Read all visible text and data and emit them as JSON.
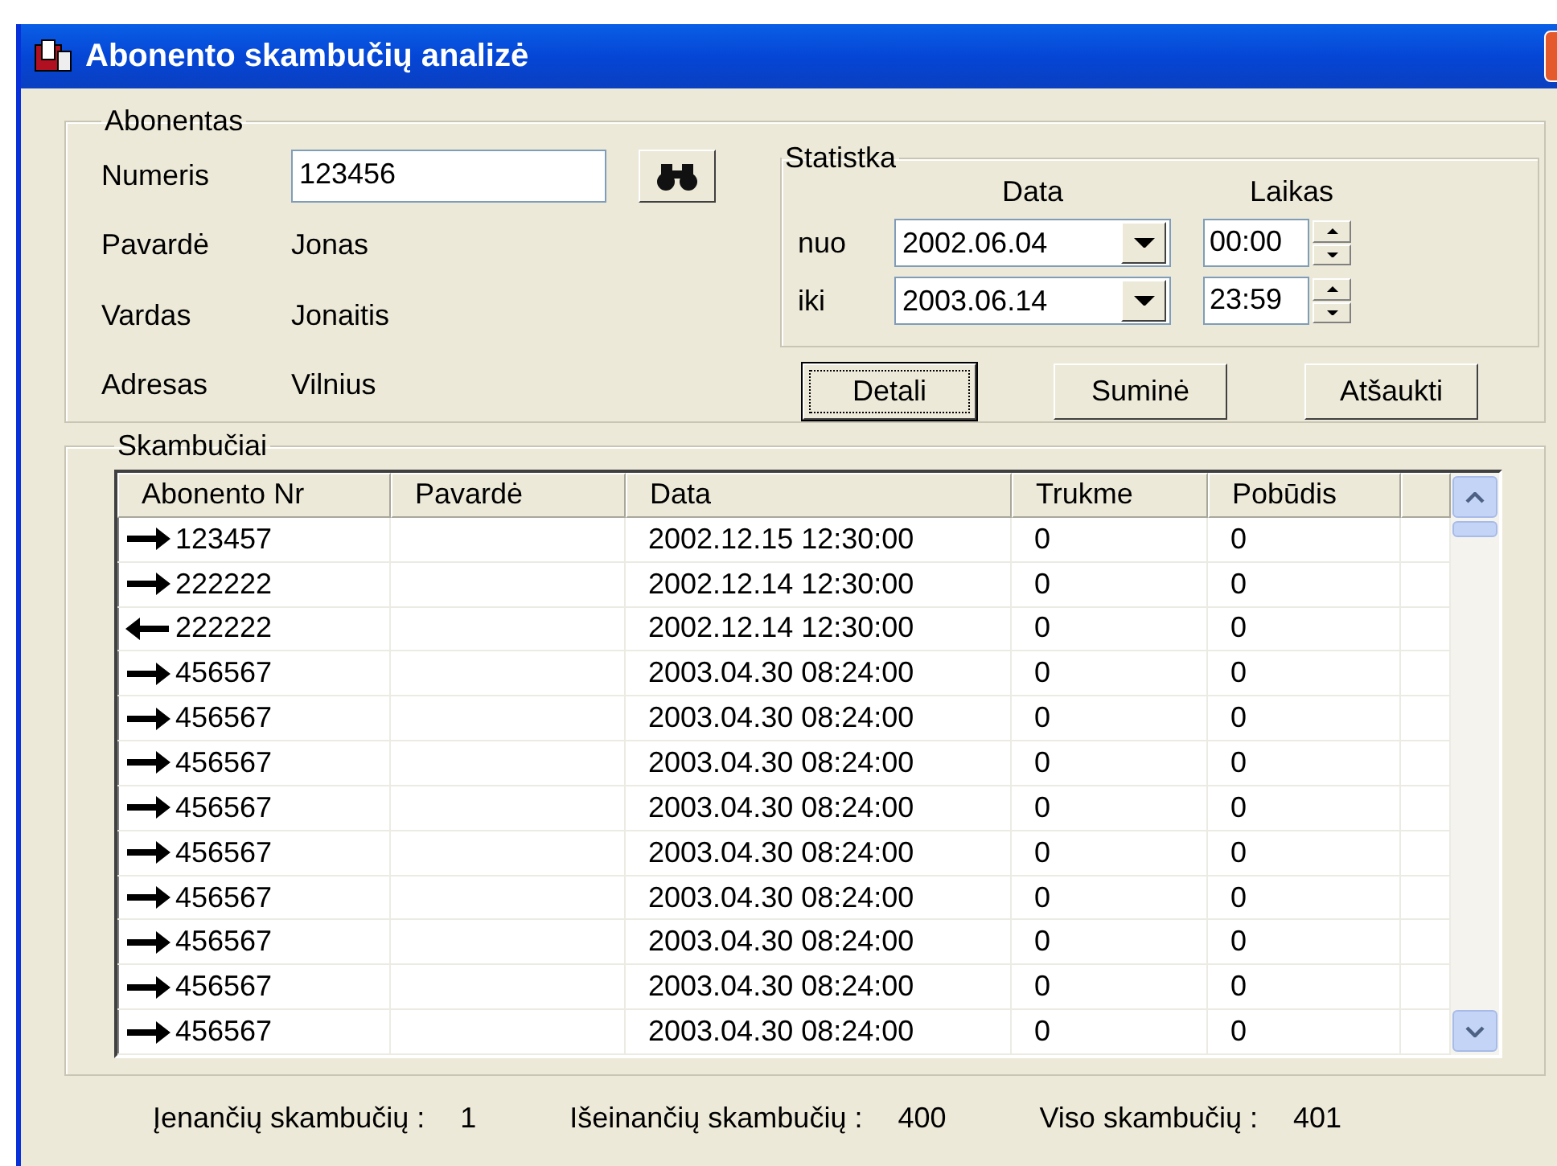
{
  "window": {
    "title": "Abonento skambučių analizė"
  },
  "subscriber": {
    "legend": "Abonentas",
    "fields": [
      {
        "label": "Numeris",
        "kind": "input",
        "value": "123456"
      },
      {
        "label": "Pavardė",
        "kind": "text",
        "value": "Jonas"
      },
      {
        "label": "Vardas",
        "kind": "text",
        "value": "Jonaitis"
      },
      {
        "label": "Adresas",
        "kind": "text",
        "value": "Vilnius"
      }
    ]
  },
  "statistics": {
    "legend": "Statistka",
    "date_header": "Data",
    "time_header": "Laikas",
    "rows": [
      {
        "label": "nuo",
        "date": "2002.06.04",
        "time": "00:00"
      },
      {
        "label": "iki",
        "date": "2003.06.14",
        "time": "23:59"
      }
    ]
  },
  "buttons": [
    {
      "label": "Detali",
      "focused": true
    },
    {
      "label": "Suminė",
      "focused": false
    },
    {
      "label": "Atšaukti",
      "focused": false
    }
  ],
  "calls": {
    "legend": "Skambučiai",
    "columns": [
      "Abonento Nr",
      "Pavardė",
      "Data",
      "Trukme",
      "Pobūdis"
    ],
    "rows": [
      {
        "kind": "outgoing",
        "number": "123457",
        "date": "2002.12.15 12:30:00",
        "duration": "0",
        "type": "0"
      },
      {
        "kind": "outgoing",
        "number": "222222",
        "date": "2002.12.14 12:30:00",
        "duration": "0",
        "type": "0"
      },
      {
        "kind": "incoming",
        "number": "222222",
        "date": "2002.12.14 12:30:00",
        "duration": "0",
        "type": "0"
      },
      {
        "kind": "outgoing",
        "number": "456567",
        "date": "2003.04.30 08:24:00",
        "duration": "0",
        "type": "0"
      },
      {
        "kind": "outgoing",
        "number": "456567",
        "date": "2003.04.30 08:24:00",
        "duration": "0",
        "type": "0"
      },
      {
        "kind": "outgoing",
        "number": "456567",
        "date": "2003.04.30 08:24:00",
        "duration": "0",
        "type": "0"
      },
      {
        "kind": "outgoing",
        "number": "456567",
        "date": "2003.04.30 08:24:00",
        "duration": "0",
        "type": "0"
      },
      {
        "kind": "outgoing",
        "number": "456567",
        "date": "2003.04.30 08:24:00",
        "duration": "0",
        "type": "0"
      },
      {
        "kind": "outgoing",
        "number": "456567",
        "date": "2003.04.30 08:24:00",
        "duration": "0",
        "type": "0"
      },
      {
        "kind": "outgoing",
        "number": "456567",
        "date": "2003.04.30 08:24:00",
        "duration": "0",
        "type": "0"
      },
      {
        "kind": "outgoing",
        "number": "456567",
        "date": "2003.04.30 08:24:00",
        "duration": "0",
        "type": "0"
      },
      {
        "kind": "outgoing",
        "number": "456567",
        "date": "2003.04.30 08:24:00",
        "duration": "0",
        "type": "0"
      }
    ]
  },
  "summary": [
    {
      "label": "Įenančių skambučių :",
      "value": "1"
    },
    {
      "label": "Išeinančių skambučių :",
      "value": "400"
    },
    {
      "label": "Viso skambučių :",
      "value": "401"
    }
  ]
}
